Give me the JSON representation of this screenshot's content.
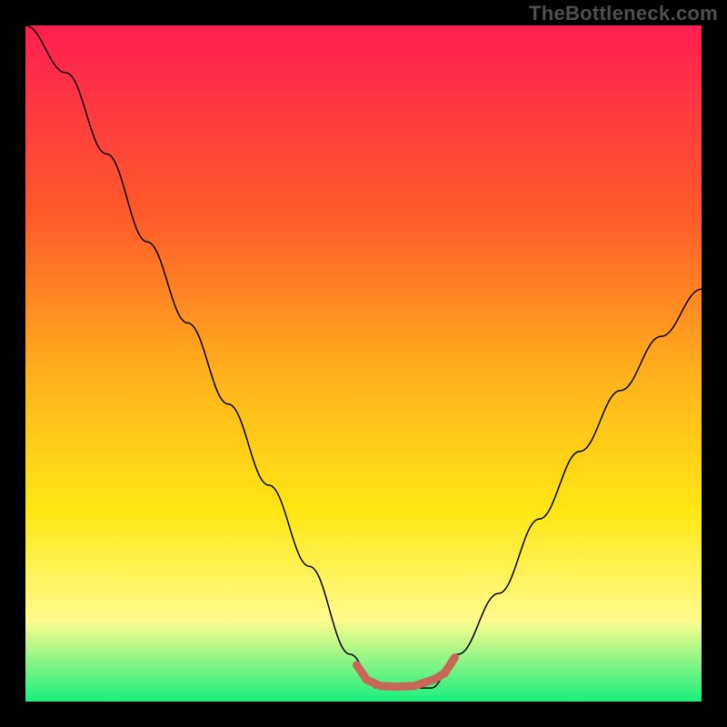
{
  "watermark": "TheBottleneck.com",
  "colors": {
    "top": "#ff1f52",
    "mid1": "#ff5a2a",
    "mid2": "#ffb21c",
    "mid3": "#ffe714",
    "mid4": "#fffb8e",
    "bottom": "#18f07e",
    "curve": "#000000",
    "marker": "#c96757"
  },
  "chart_data": {
    "type": "line",
    "title": "",
    "xlabel": "",
    "ylabel": "",
    "xlim": [
      0,
      100
    ],
    "ylim": [
      0,
      100
    ],
    "series": [
      {
        "name": "bottleneck-curve",
        "x": [
          0,
          6,
          12,
          18,
          24,
          30,
          36,
          42,
          48,
          52,
          56,
          60,
          64,
          70,
          76,
          82,
          88,
          94,
          100
        ],
        "y": [
          100,
          93,
          81,
          68,
          56,
          44,
          32,
          20,
          7,
          2,
          2,
          2,
          7,
          16,
          27,
          37,
          46,
          54,
          61
        ]
      },
      {
        "name": "optimal-range-marker",
        "x": [
          49,
          50.5,
          52.5,
          55,
          57.5,
          60.5,
          62,
          63.5
        ],
        "y": [
          5.4,
          3.2,
          2.3,
          2.2,
          2.3,
          3.3,
          4.2,
          6.5
        ]
      }
    ]
  }
}
